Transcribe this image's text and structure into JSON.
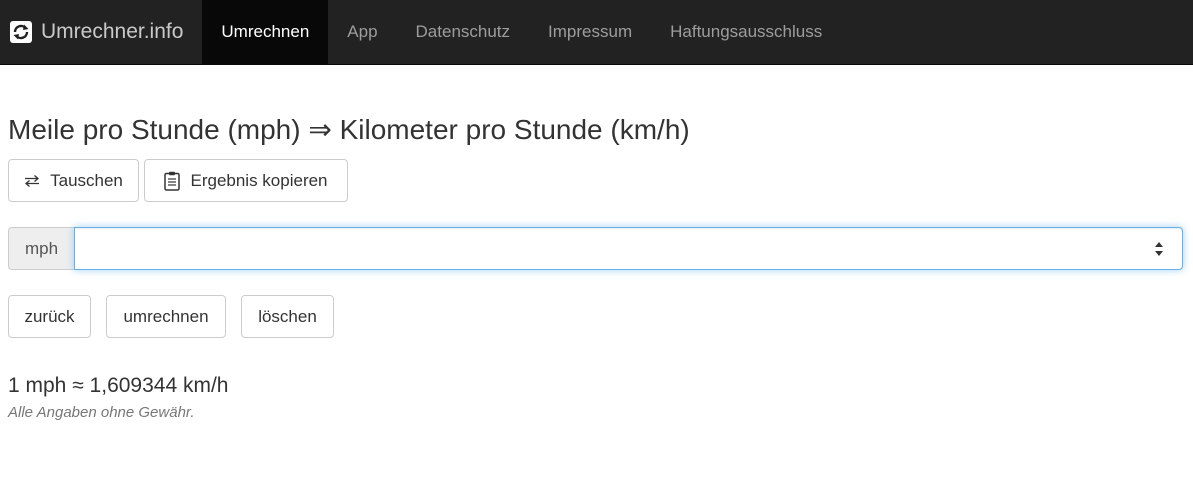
{
  "navbar": {
    "brand": "Umrechner.info",
    "brand_icon": "refresh-icon",
    "items": [
      {
        "label": "Umrechnen",
        "active": true
      },
      {
        "label": "App",
        "active": false
      },
      {
        "label": "Datenschutz",
        "active": false
      },
      {
        "label": "Impressum",
        "active": false
      },
      {
        "label": "Haftungsausschluss",
        "active": false
      }
    ],
    "colors": {
      "background": "#222222",
      "active_background": "#080808",
      "text": "#9d9d9d",
      "active_text": "#ffffff"
    }
  },
  "main": {
    "title": "Meile pro Stunde (mph) ⇒ Kilometer pro Stunde (km/h)",
    "actions": {
      "swap_label": "Tauschen",
      "swap_icon": "swap-arrows-icon",
      "copy_label": "Ergebnis kopieren",
      "copy_icon": "clipboard-icon"
    },
    "input": {
      "unit": "mph",
      "value": "",
      "placeholder": ""
    },
    "buttons": {
      "back": "zurück",
      "convert": "umrechnen",
      "clear": "löschen"
    },
    "result": "1 mph ≈ 1,609344 km/h",
    "disclaimer": "Alle Angaben ohne Gewähr."
  }
}
